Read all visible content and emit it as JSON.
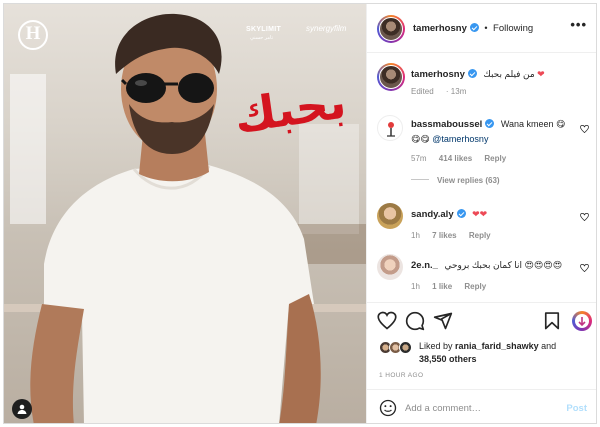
{
  "post_image": {
    "logo_letter": "H",
    "brand_left": "SKYLIMIT",
    "brand_left_sub": "تامر حسني",
    "brand_right": "synergyfilm",
    "title_ar": "بحبك"
  },
  "header": {
    "username": "tamerhosny",
    "separator": "•",
    "follow_state": "Following",
    "more_label": "•••"
  },
  "caption": {
    "username": "tamerhosny",
    "text": "من فيلم بحبك",
    "emoji": "❤",
    "edited": "Edited",
    "time": "13m"
  },
  "comments": [
    {
      "username": "bassmaboussel",
      "text": "Wana kmeen 😋",
      "text2": "😋😋",
      "mention": "@tamerhosny",
      "time": "57m",
      "likes": "414 likes",
      "reply": "Reply",
      "view_replies": "View replies (63)"
    },
    {
      "username": "sandy.aly",
      "text": "❤❤",
      "time": "1h",
      "likes": "7 likes",
      "reply": "Reply"
    },
    {
      "username": "2e.n._",
      "text": "انا كمان بحبك بروحي 😍😍😍😍",
      "time": "1h",
      "likes": "1 like",
      "reply": "Reply"
    }
  ],
  "liked_by": {
    "prefix": "Liked by",
    "user": "rania_farid_shawky",
    "and": "and",
    "others": "38,550 others"
  },
  "timestamp": "1 HOUR AGO",
  "add_comment": {
    "placeholder": "Add a comment…",
    "post_label": "Post"
  },
  "colors": {
    "verified": "#3897f0",
    "title_red": "#d4141f",
    "mention": "#00376b",
    "post_disabled": "#b2dffc",
    "heart_red": "#ed4956"
  },
  "icons": [
    "heart-icon",
    "comment-icon",
    "share-icon",
    "bookmark-icon",
    "emoji-icon",
    "verified-icon",
    "more-icon"
  ]
}
